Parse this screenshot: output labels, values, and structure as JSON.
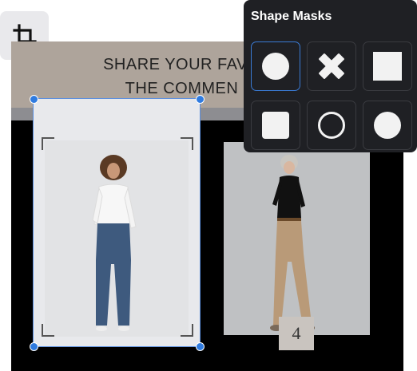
{
  "toolbar": {
    "crop_icon": "crop-icon"
  },
  "canvas": {
    "banner_line1": "SHARE YOUR FAVO",
    "banner_line2": "THE COMMEN",
    "page_number": "4"
  },
  "mask_panel": {
    "title": "Shape Masks",
    "options": [
      {
        "shape": "circle",
        "selected": true
      },
      {
        "shape": "cross",
        "selected": false
      },
      {
        "shape": "square",
        "selected": false
      },
      {
        "shape": "rounded-square",
        "selected": false
      },
      {
        "shape": "circle-outline",
        "selected": false
      },
      {
        "shape": "circle",
        "selected": false
      }
    ]
  },
  "colors": {
    "accent": "#3a7bd5",
    "panel_bg": "#1f2024",
    "banner_bg": "#aea49b"
  }
}
